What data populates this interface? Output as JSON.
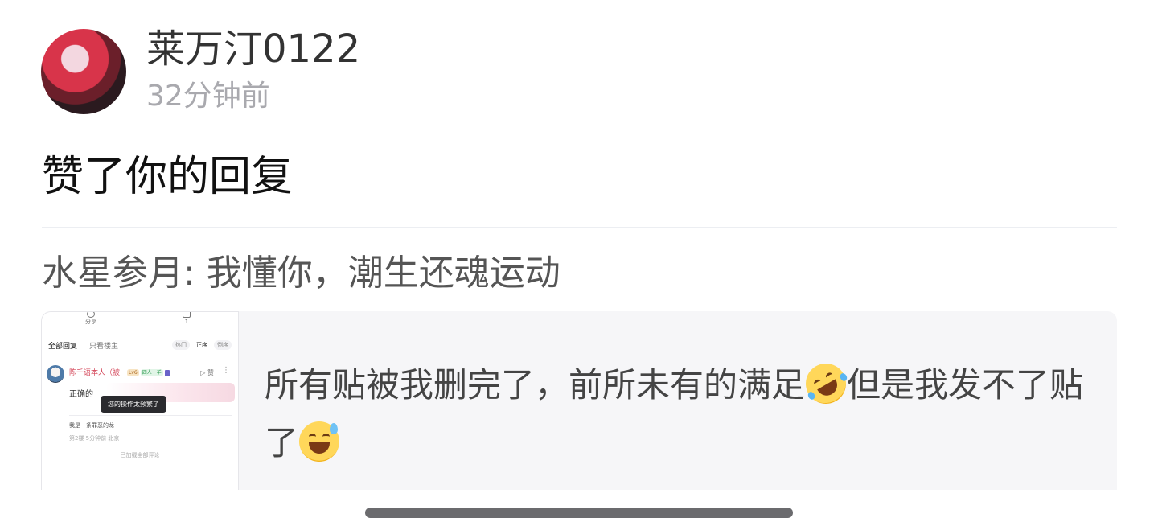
{
  "notification": {
    "user": {
      "name": "莱万汀0122",
      "time": "32分钟前"
    },
    "action_text": "赞了你的回复",
    "quoted_reply": "水星参月: 我懂你，潮生还魂运动"
  },
  "post": {
    "text_part1": "所有贴被我删完了，前所未有的满足",
    "text_part2": "但是我发不了贴了",
    "emoji_1": "rolling-on-floor-laughing-emoji",
    "emoji_2": "grinning-sweat-emoji",
    "thumbnail": {
      "share_label": "分享",
      "count_label": "1",
      "tab_all": "全部回复",
      "tab_author_only": "只看楼主",
      "sort_options": [
        "热门",
        "正序",
        "倒序"
      ],
      "active_sort": "正序",
      "commenter_name": "陈千语本人（被",
      "badge_level": "Lv6",
      "badge_shield": "四人一羊",
      "like_label": "赞",
      "comment_text": "正确的",
      "toast": "您的操作太频繁了",
      "subreply_text": "我是一条罪恶的龙",
      "meta_text": "第2楼 5分钟前 北京",
      "loaded_all": "已加载全部评论"
    }
  },
  "colors": {
    "card_background": "#f6f6f8",
    "secondary_text": "#a9a9ae",
    "commenter_name": "#d4475a"
  }
}
